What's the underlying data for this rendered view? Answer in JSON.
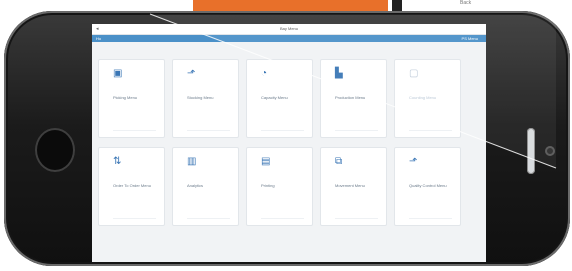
{
  "background": {
    "corner_text": "Back",
    "colors": {
      "orange": "#e8702a",
      "dark": "#222222"
    }
  },
  "app": {
    "window_title": "Bay Menu",
    "back_icon": "back-arrow-icon",
    "status_left": "",
    "status_right": "",
    "home_link": "Ho",
    "user_label": "PS Menu"
  },
  "tiles": [
    {
      "label": "Picking Menu",
      "icon": "pallet-icon",
      "glyph": "▣"
    },
    {
      "label": "Stocking Menu",
      "icon": "putaway-icon",
      "glyph": "⬏"
    },
    {
      "label": "Capacity Menu",
      "icon": "capacity-icon",
      "glyph": "◔"
    },
    {
      "label": "Production Menu",
      "icon": "production-icon",
      "glyph": "▙"
    },
    {
      "label": "Counting Menu",
      "icon": "counting-icon",
      "glyph": "▢"
    },
    {
      "label": "Order To Order Menu",
      "icon": "transfer-icon",
      "glyph": "⇅"
    },
    {
      "label": "Analytics",
      "icon": "analytics-icon",
      "glyph": "▥"
    },
    {
      "label": "Printing",
      "icon": "printer-icon",
      "glyph": "▤"
    },
    {
      "label": "Movement Menu",
      "icon": "movement-icon",
      "glyph": "⧉"
    },
    {
      "label": "Quality Control Menu",
      "icon": "quality-icon",
      "glyph": "⬏"
    }
  ],
  "colors": {
    "accent": "#3a76b5",
    "header_bar": "#4a90c8"
  }
}
